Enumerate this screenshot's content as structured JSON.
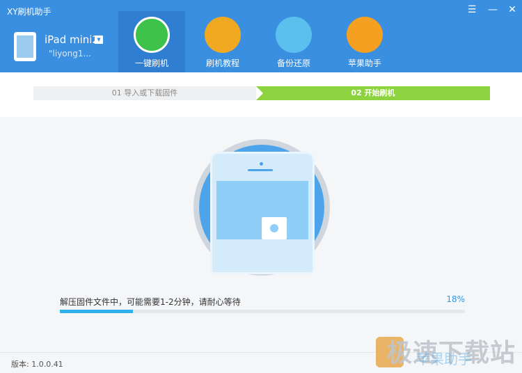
{
  "window": {
    "title": "XY刷机助手"
  },
  "device": {
    "name": "iPad mini2",
    "account": "\"liyong1..."
  },
  "nav": {
    "tabs": [
      {
        "label": "一键刷机",
        "active": true,
        "icon": "refresh-icon"
      },
      {
        "label": "刷机教程",
        "icon": "lamp-icon"
      },
      {
        "label": "备份还原",
        "icon": "disc-drive-icon"
      },
      {
        "label": "苹果助手",
        "icon": "owl-icon"
      }
    ]
  },
  "steps": [
    {
      "label": "01 导入或下载固件",
      "active": false
    },
    {
      "label": "02 开始刷机",
      "active": true
    }
  ],
  "progress": {
    "status": "解压固件文件中，可能需要1-2分钟，请耐心等待",
    "percent_label": "18%",
    "value": 0.18
  },
  "footer": {
    "version": "版本: 1.0.0.41"
  },
  "watermark": {
    "text": "极速下载站",
    "sub": "苹果助手"
  },
  "colors": {
    "header": "#3a8fe0",
    "active_tab": "#2f7ed2",
    "step_active": "#8dd340",
    "progress": "#2fb1ee"
  }
}
